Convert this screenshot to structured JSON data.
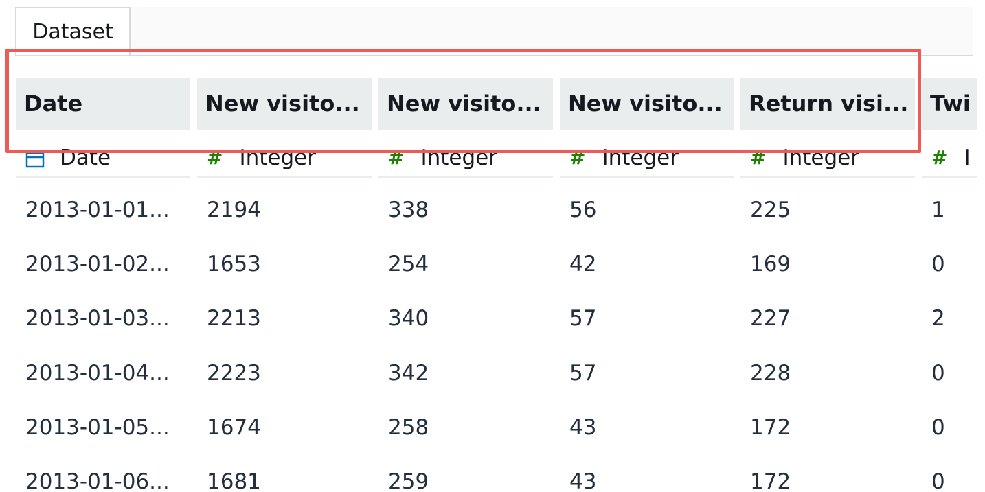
{
  "tabs": [
    {
      "label": "Dataset"
    }
  ],
  "columns": [
    {
      "header": "Date",
      "type_label": "Date",
      "type_icon": "calendar-icon"
    },
    {
      "header": "New visito...",
      "type_label": "Integer",
      "type_icon": "hash-icon"
    },
    {
      "header": "New visito...",
      "type_label": "Integer",
      "type_icon": "hash-icon"
    },
    {
      "header": "New visito...",
      "type_label": "Integer",
      "type_icon": "hash-icon"
    },
    {
      "header": "Return visi...",
      "type_label": "Integer",
      "type_icon": "hash-icon"
    },
    {
      "header": "Twi",
      "type_label": "I",
      "type_icon": "hash-icon"
    }
  ],
  "type_hash_glyph": "#",
  "rows": [
    [
      "2013-01-01...",
      "2194",
      "338",
      "56",
      "225",
      "1"
    ],
    [
      "2013-01-02...",
      "1653",
      "254",
      "42",
      "169",
      "0"
    ],
    [
      "2013-01-03...",
      "2213",
      "340",
      "57",
      "227",
      "2"
    ],
    [
      "2013-01-04...",
      "2223",
      "342",
      "57",
      "228",
      "0"
    ],
    [
      "2013-01-05...",
      "1674",
      "258",
      "43",
      "172",
      "0"
    ],
    [
      "2013-01-06...",
      "1681",
      "259",
      "43",
      "172",
      "0"
    ]
  ],
  "colors": {
    "highlight": "#ec5b56",
    "header_bg": "#eaeded",
    "integer_icon": "#1d8102",
    "date_icon": "#0073bb"
  }
}
